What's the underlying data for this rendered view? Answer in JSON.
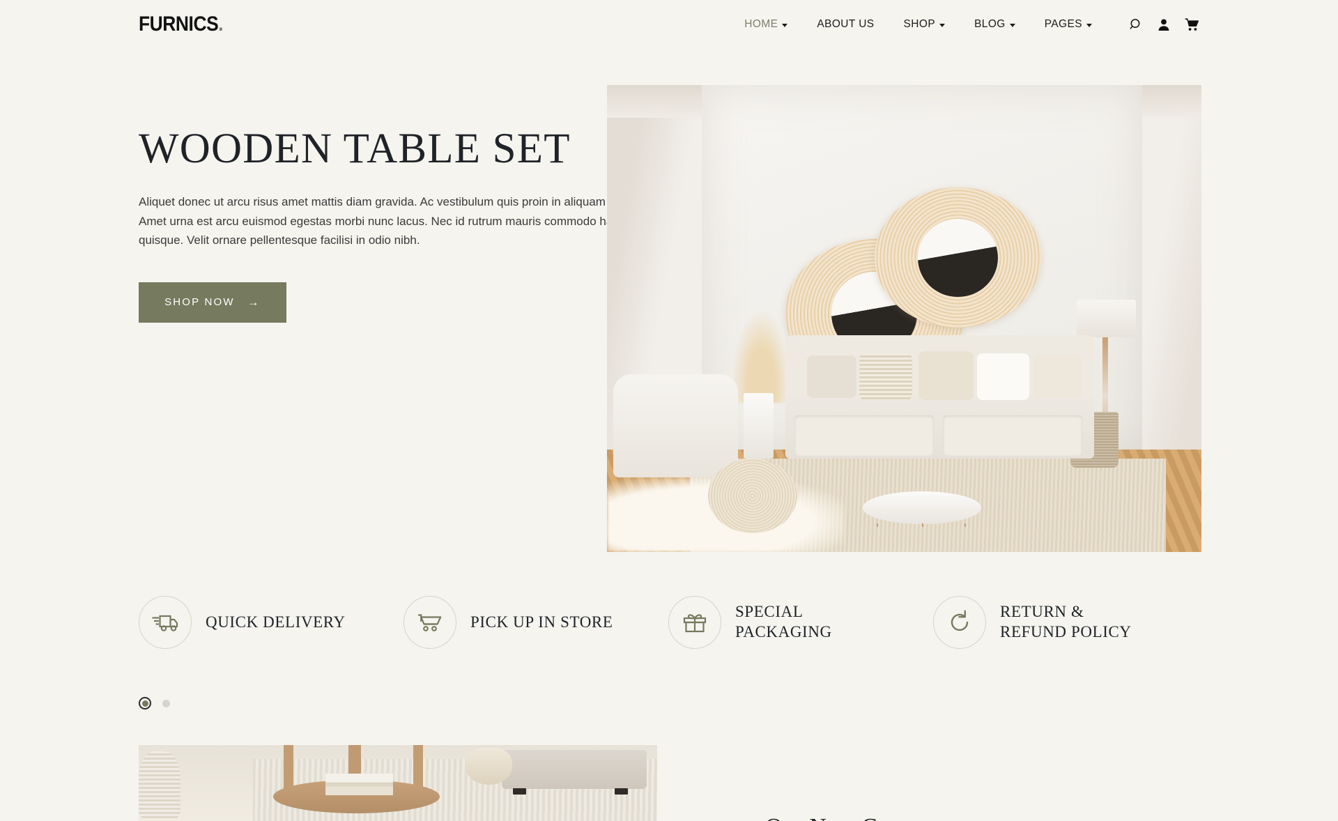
{
  "theme": {
    "background": "#f5f4ef",
    "accent_olive": "#767a5e",
    "accent_olive_light": "#7d7f6e",
    "text_dark": "#1f2328",
    "circle_border": "#d8d4c6"
  },
  "header": {
    "brand": "FURNICS",
    "brand_dot": ".",
    "nav": [
      {
        "label": "HOME",
        "has_caret": true,
        "active": true
      },
      {
        "label": "ABOUT US",
        "has_caret": false,
        "active": false
      },
      {
        "label": "SHOP",
        "has_caret": true,
        "active": false
      },
      {
        "label": "BLOG",
        "has_caret": true,
        "active": false
      },
      {
        "label": "PAGES",
        "has_caret": true,
        "active": false
      }
    ],
    "icons": [
      {
        "name": "search-icon"
      },
      {
        "name": "user-account-icon"
      },
      {
        "name": "shopping-cart-icon"
      }
    ]
  },
  "hero": {
    "title": "WOODEN TABLE SET",
    "paragraph": "Aliquet donec ut arcu risus amet mattis diam gravida. Ac vestibulum quis proin in aliquam et et auctor. Amet urna est arcu euismod egestas morbi nunc lacus. Nec id rutrum mauris commodo habitant amet quisque. Velit ornare pellentesque facilisi in odio nibh.",
    "cta_label": "SHOP NOW",
    "cta_arrow": "→",
    "image_alt": "Beige minimalist living room with cream sofa, rattan wall mirrors, pampas grass, floor lamp and round marble coffee table"
  },
  "features": [
    {
      "icon": "delivery-truck-icon",
      "label": "QUICK DELIVERY"
    },
    {
      "icon": "shopping-cart-icon",
      "label": "PICK UP IN STORE"
    },
    {
      "icon": "gift-box-icon",
      "label": "SPECIAL PACKAGING"
    },
    {
      "icon": "refresh-rotate-icon",
      "label": "RETURN & REFUND POLICY"
    }
  ],
  "carousel": {
    "dots": [
      {
        "label": "slide-1",
        "active": true
      },
      {
        "label": "slide-2",
        "active": false
      }
    ]
  },
  "bottom": {
    "image_alt": "Close-up of round wooden coffee table with stacked books on a light rug beside a sofa",
    "cut_text": "Our New Company"
  }
}
